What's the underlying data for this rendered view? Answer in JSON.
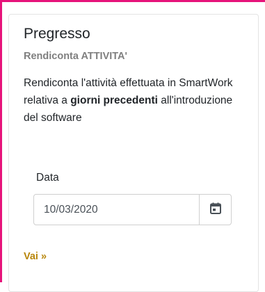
{
  "card": {
    "title": "Pregresso",
    "subtitle": "Rendiconta ATTIVITA'",
    "text_before": "Rendiconta l'attività effettuata in SmartWork relativa a ",
    "text_bold": "giorni precedenti",
    "text_after": " all'introduzione del software"
  },
  "form": {
    "date_label": "Data",
    "date_value": "10/03/2020",
    "calendar_icon": "calendar-icon"
  },
  "action": {
    "go_label": "Vai »"
  },
  "colors": {
    "frame_border": "#e6137a",
    "link": "#b8860b",
    "subtitle": "#7f7f7f"
  }
}
